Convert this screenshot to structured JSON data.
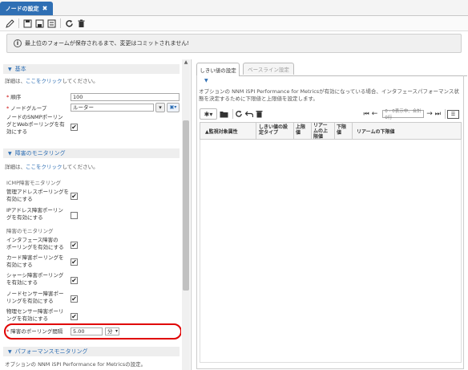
{
  "tab": {
    "title": "ノードの設定",
    "close": "✖"
  },
  "banner": {
    "text": "最上位のフォームが保存されるまで、変更はコミットされません!"
  },
  "basic": {
    "header": "基本",
    "help_prefix": "詳細は、",
    "help_link": "ここをクリック",
    "help_suffix": "してください。",
    "order_label": "順序",
    "order_value": "100",
    "nodegroup_label": "ノードグループ",
    "nodegroup_value": "ルーター",
    "snmp_label_1": "ノードのSNMPポーリン",
    "snmp_label_2": "グとWebポーリングを有",
    "snmp_label_3": "効にする"
  },
  "fault": {
    "header": "障害のモニタリング",
    "help_prefix": "詳細は、",
    "help_link": "ここをクリック",
    "help_suffix": "してください。",
    "icmp_group": "ICMP障害モニタリング",
    "mgmt_label_1": "管理アドレスポーリングを",
    "mgmt_label_2": "有効にする",
    "ip_label_1": "IPアドレス障害ポーリン",
    "ip_label_2": "グを有効にする",
    "fault_group": "障害のモニタリング",
    "if_label_1": "インタフェース障害の",
    "if_label_2": "ポーリングを有効にする",
    "card_label_1": "カード障害ポーリングを",
    "card_label_2": "有効にする",
    "chassis_label_1": "シャーシ障害ポーリング",
    "chassis_label_2": "を有効にする",
    "nodesensor_label_1": "ノードセンサー障害ポー",
    "nodesensor_label_2": "リングを有効にする",
    "physensor_label_1": "物理センサー障害ポーリ",
    "physensor_label_2": "ングを有効にする",
    "interval_label": "障害のポーリング間隔",
    "interval_value": "5.00",
    "interval_unit": "分"
  },
  "perf": {
    "header": "パフォーマンスモニタリング",
    "help": "オプションの NNM iSPI Performance for Metricsの設定。"
  },
  "right": {
    "tab_threshold": "しきい値の設定",
    "tab_baseline": "ベースライン設定",
    "desc": "オプションの NNM iSPI Performance for Metricsが有効になっている場合、インタフェースパフォーマンス状態を決定するために下限値と上限値を設定します。",
    "page_text": "0 - 0表示中、合計0行",
    "col_attr": "▲監視対象属性",
    "col_type_1": "しきい値の設",
    "col_type_2": "定タイプ",
    "col_upper_1": "上限",
    "col_upper_2": "値",
    "col_rearm_1": "リアー",
    "col_rearm_2": "ムの上",
    "col_rearm_3": "限値",
    "col_lower_1": "下限",
    "col_lower_2": "値",
    "col_lowrearm": "リアームの下限値"
  },
  "checkmark": "✔",
  "colors": {
    "accent": "#2f6fb4",
    "highlight": "#e00000"
  }
}
